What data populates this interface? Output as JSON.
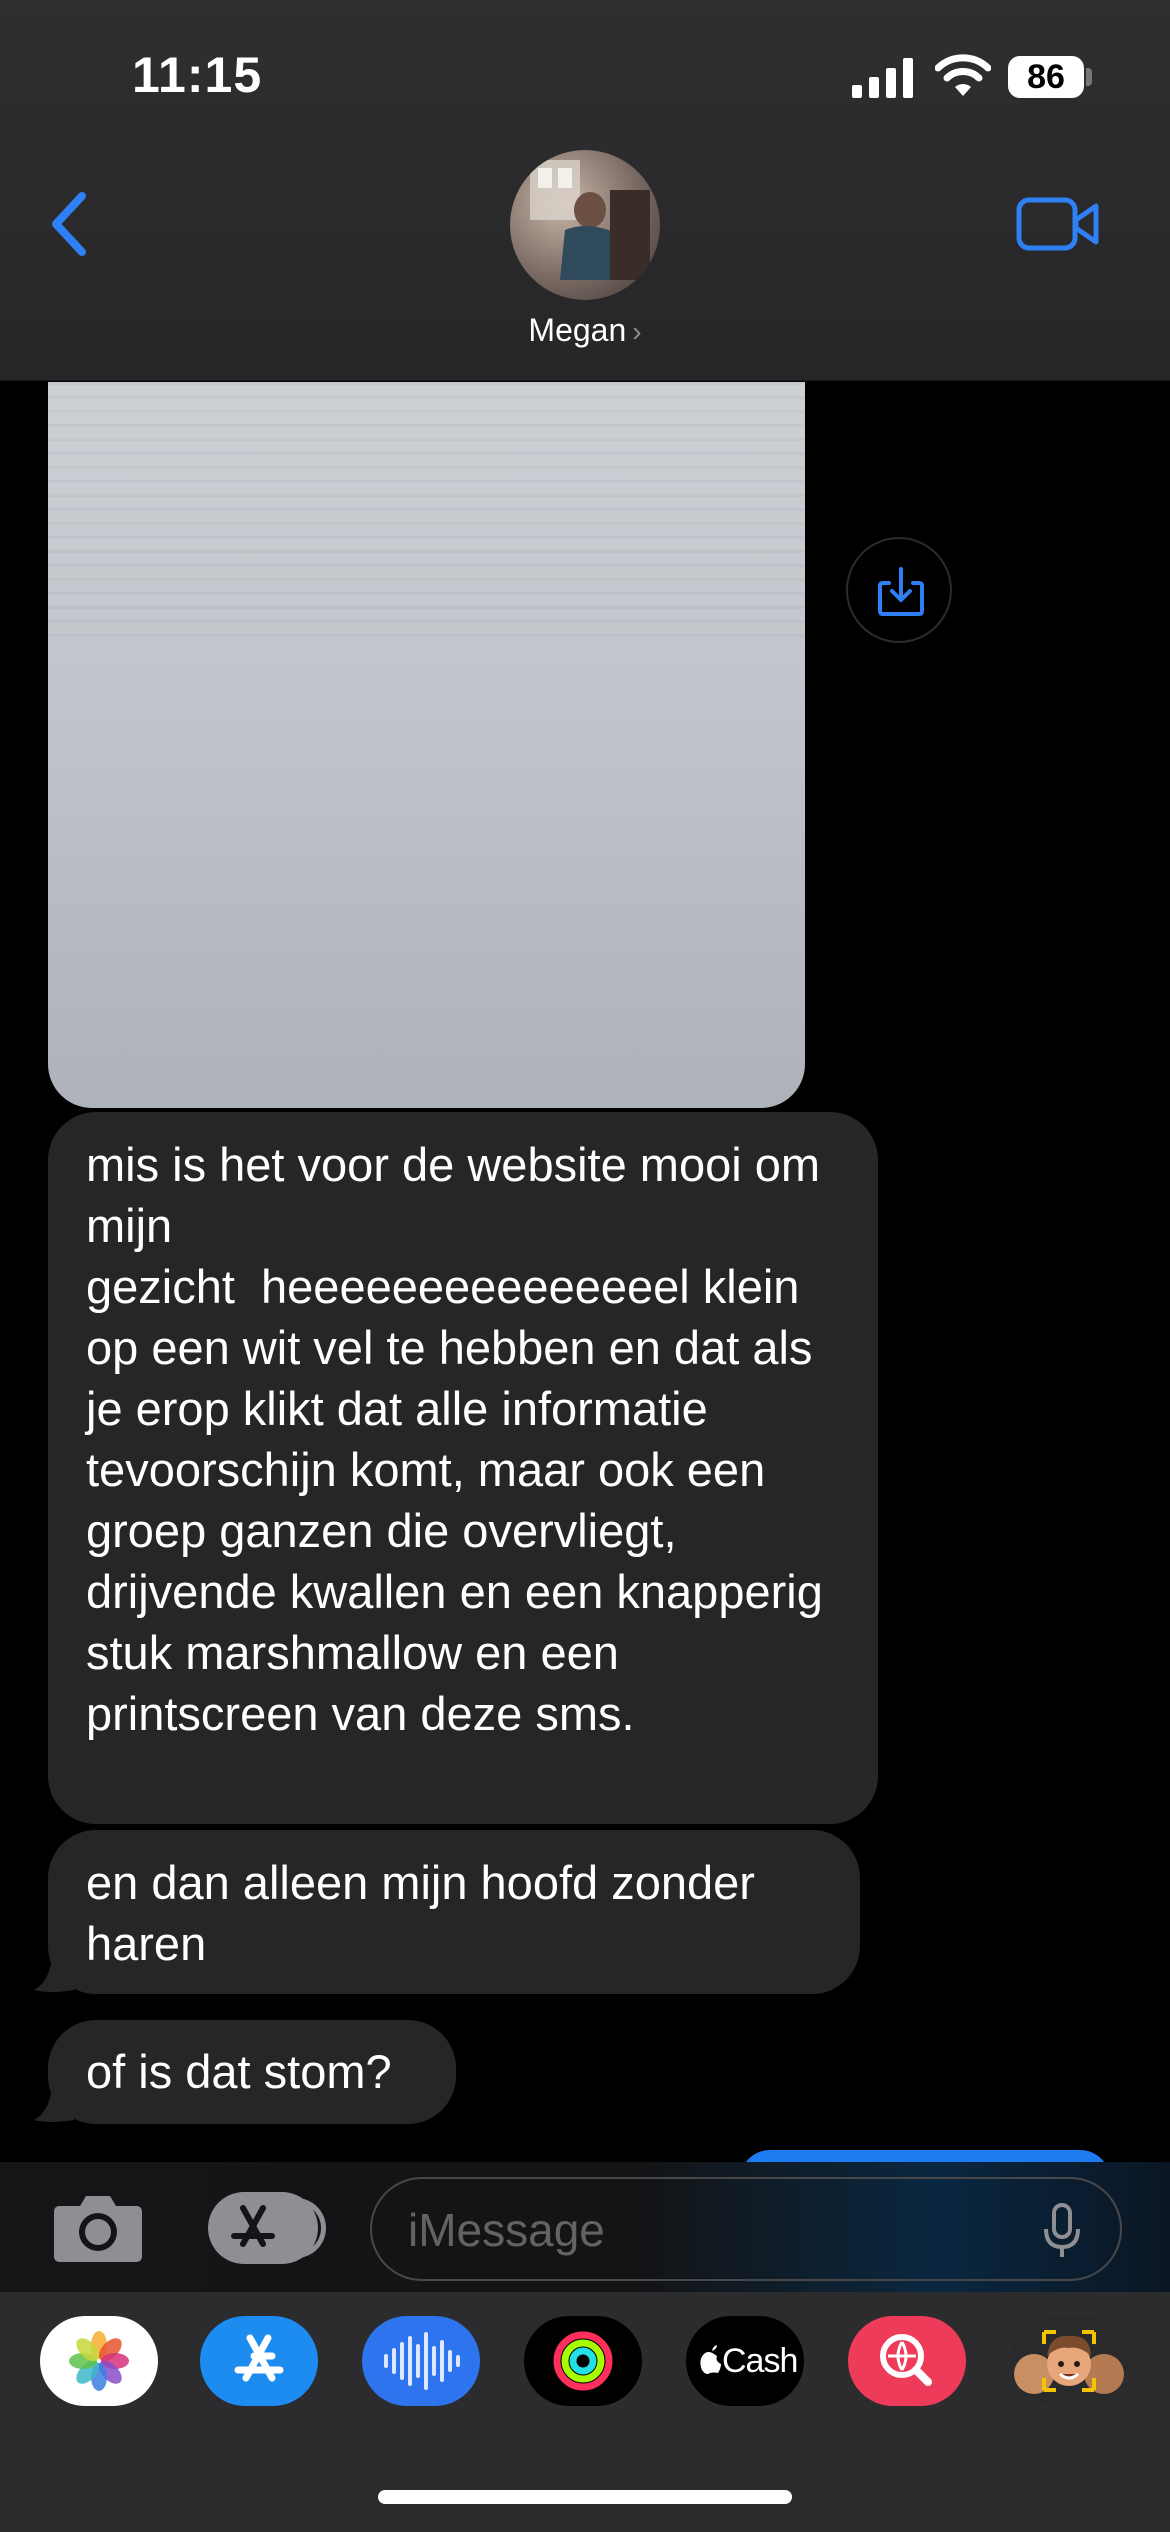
{
  "status_bar": {
    "time": "11:15",
    "battery": "86"
  },
  "header": {
    "contact_name": "Megan",
    "chevron": "›"
  },
  "messages": [
    {
      "text": "mis is het voor de website mooi om mijn\ngezicht  heeeeeeeeeeeeeeel klein op een wit vel te hebben en dat als je erop klikt dat alle informatie tevoorschijn komt, maar ook een groep ganzen die overvliegt, drijvende kwallen en een knapperig stuk marshmallow en een printscreen van deze sms."
    },
    {
      "text": "en dan alleen mijn hoofd zonder haren"
    },
    {
      "text": "of is dat stom?"
    }
  ],
  "input": {
    "placeholder": "iMessage"
  },
  "app_tray": {
    "cash_label": "Cash"
  },
  "colors": {
    "accent": "#2f7ff5",
    "bubble": "#262628",
    "background": "#000000"
  },
  "icons": [
    "back-chevron-icon",
    "video-call-icon",
    "save-photo-icon",
    "camera-icon",
    "apps-icon",
    "mic-icon",
    "photos-icon",
    "app-store-icon",
    "audio-message-icon",
    "activity-icon",
    "apple-cash-icon",
    "images-search-icon",
    "memoji-icon"
  ]
}
